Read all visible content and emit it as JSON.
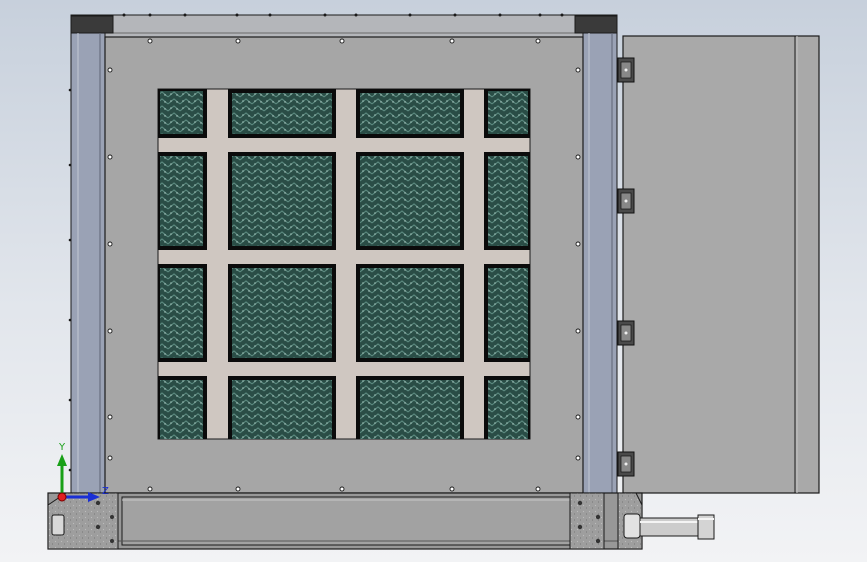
{
  "viewport": {
    "background_top": "#c7d0dc",
    "background_bottom": "#f2f3f5"
  },
  "model": {
    "housing_color": "#a6a6a6",
    "frame_post_color": "#9aa2b5",
    "top_rail_color": "#b4b6ba",
    "cap_color": "#3a3a3a",
    "grid_color": "#cfc7c1",
    "media_color": "#2a4d46",
    "media_highlight_color": "#8fb3a8",
    "door_color": "#a9a9a9",
    "base_color": "#989898",
    "pipe_color": "#cccccc",
    "outline_color": "#1a1a1a"
  },
  "triad": {
    "y_label": "Y",
    "z_label": "Z",
    "x_color": "#e02020",
    "y_color": "#18a018",
    "z_color": "#1a2fd6"
  }
}
